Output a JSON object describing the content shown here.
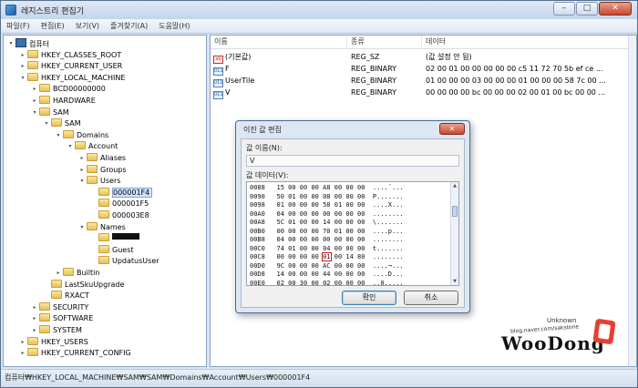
{
  "window": {
    "title": "레지스트리 편집기"
  },
  "menu": [
    "파일(F)",
    "편집(E)",
    "보기(V)",
    "즐겨찾기(A)",
    "도움말(H)"
  ],
  "tree": [
    {
      "label": "컴퓨터",
      "depth": 0,
      "toggle": "▾",
      "icon": "computer"
    },
    {
      "label": "HKEY_CLASSES_ROOT",
      "depth": 1,
      "toggle": "▸",
      "icon": "folder"
    },
    {
      "label": "HKEY_CURRENT_USER",
      "depth": 1,
      "toggle": "▸",
      "icon": "folder"
    },
    {
      "label": "HKEY_LOCAL_MACHINE",
      "depth": 1,
      "toggle": "▾",
      "icon": "folder"
    },
    {
      "label": "BCD00000000",
      "depth": 2,
      "toggle": "▸",
      "icon": "folder"
    },
    {
      "label": "HARDWARE",
      "depth": 2,
      "toggle": "▸",
      "icon": "folder"
    },
    {
      "label": "SAM",
      "depth": 2,
      "toggle": "▾",
      "icon": "folder"
    },
    {
      "label": "SAM",
      "depth": 3,
      "toggle": "▾",
      "icon": "folder"
    },
    {
      "label": "Domains",
      "depth": 4,
      "toggle": "▾",
      "icon": "folder"
    },
    {
      "label": "Account",
      "depth": 5,
      "toggle": "▾",
      "icon": "folder"
    },
    {
      "label": "Aliases",
      "depth": 6,
      "toggle": "▸",
      "icon": "folder"
    },
    {
      "label": "Groups",
      "depth": 6,
      "toggle": "▸",
      "icon": "folder"
    },
    {
      "label": "Users",
      "depth": 6,
      "toggle": "▾",
      "icon": "folder"
    },
    {
      "label": "000001F4",
      "depth": 7,
      "toggle": "",
      "icon": "folder",
      "selected": true
    },
    {
      "label": "000001F5",
      "depth": 7,
      "toggle": "",
      "icon": "folder"
    },
    {
      "label": "000003E8",
      "depth": 7,
      "toggle": "",
      "icon": "folder"
    },
    {
      "label": "Names",
      "depth": 6,
      "toggle": "▾",
      "icon": "folder"
    },
    {
      "label": "",
      "depth": 7,
      "toggle": "",
      "icon": "folder",
      "redacted": true
    },
    {
      "label": "Guest",
      "depth": 7,
      "toggle": "",
      "icon": "folder"
    },
    {
      "label": "UpdatusUser",
      "depth": 7,
      "toggle": "",
      "icon": "folder"
    },
    {
      "label": "Builtin",
      "depth": 4,
      "toggle": "▸",
      "icon": "folder"
    },
    {
      "label": "LastSkuUpgrade",
      "depth": 3,
      "toggle": "",
      "icon": "folder"
    },
    {
      "label": "RXACT",
      "depth": 3,
      "toggle": "",
      "icon": "folder"
    },
    {
      "label": "SECURITY",
      "depth": 2,
      "toggle": "▸",
      "icon": "folder"
    },
    {
      "label": "SOFTWARE",
      "depth": 2,
      "toggle": "▸",
      "icon": "folder"
    },
    {
      "label": "SYSTEM",
      "depth": 2,
      "toggle": "▸",
      "icon": "folder"
    },
    {
      "label": "HKEY_USERS",
      "depth": 1,
      "toggle": "▸",
      "icon": "folder"
    },
    {
      "label": "HKEY_CURRENT_CONFIG",
      "depth": 1,
      "toggle": "▸",
      "icon": "folder"
    }
  ],
  "list": {
    "headers": [
      "이름",
      "종류",
      "데이터"
    ],
    "rows": [
      {
        "icon": "ab",
        "name": "(기본값)",
        "type": "REG_SZ",
        "data": "(값 설정 안 됨)"
      },
      {
        "icon": "bin",
        "name": "F",
        "type": "REG_BINARY",
        "data": "02 00 01 00 00 00 00 00 c5 11 72 70 5b ef ce ..."
      },
      {
        "icon": "bin",
        "name": "UserTile",
        "type": "REG_BINARY",
        "data": "01 00 00 00 03 00 00 00 01 00 00 00 58 7c 00 ..."
      },
      {
        "icon": "bin",
        "name": "V",
        "type": "REG_BINARY",
        "data": "00 00 00 00 bc 00 00 00 02 00 01 00 bc 00 00 ..."
      }
    ]
  },
  "statusbar": "컴퓨터₩HKEY_LOCAL_MACHINE₩SAM₩SAM₩Domains₩Account₩Users₩000001F4",
  "dialog": {
    "title": "이진 값 편집",
    "close": "✕",
    "name_label": "값 이름(N):",
    "name_value": "V",
    "data_label": "값 데이터(V):",
    "hex_rows": [
      {
        "addr": "0088",
        "bytes": "15 00 00 00 A8 00 00 00",
        "ascii": "....¨..."
      },
      {
        "addr": "0090",
        "bytes": "50 01 00 00 08 00 00 00",
        "ascii": "P......."
      },
      {
        "addr": "0098",
        "bytes": "01 00 00 00 58 01 00 00",
        "ascii": "....X..."
      },
      {
        "addr": "00A0",
        "bytes": "04 00 00 00 00 00 00 00",
        "ascii": "........"
      },
      {
        "addr": "00A8",
        "bytes": "5C 01 00 00 14 00 00 00",
        "ascii": "\\......."
      },
      {
        "addr": "00B0",
        "bytes": "00 00 00 00 70 01 00 00",
        "ascii": "....p..."
      },
      {
        "addr": "00B8",
        "bytes": "04 00 00 00 00 00 00 00",
        "ascii": "........"
      },
      {
        "addr": "00C0",
        "bytes": "74 01 00 00 04 00 00 00",
        "ascii": "t......."
      },
      {
        "addr": "00C8",
        "bytes": "00 00 00 00",
        "sel": "01",
        "rest": " 00 14 80",
        "ascii": "........"
      },
      {
        "addr": "00D0",
        "bytes": "9C 00 00 00 AC 00 00 00",
        "ascii": "....¬..."
      },
      {
        "addr": "00D8",
        "bytes": "14 00 00 00 44 00 00 00",
        "ascii": "....D..."
      },
      {
        "addr": "00E0",
        "bytes": "02 00 30 00 02 00 00 00",
        "ascii": "..0....."
      }
    ],
    "ok": "확인",
    "cancel": "취소"
  },
  "watermark": {
    "main": "WooDong",
    "url": "blog.naver.com/sakstone",
    "small": "Unknown"
  }
}
